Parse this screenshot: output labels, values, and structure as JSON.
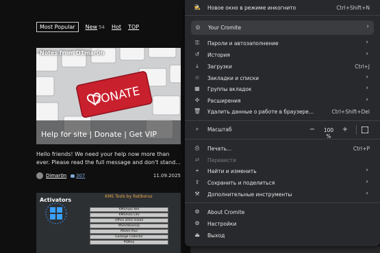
{
  "site": {
    "filters": [
      {
        "label": "Most Popular",
        "count": ""
      },
      {
        "label": "New",
        "count": "54"
      },
      {
        "label": "Hot",
        "count": ""
      },
      {
        "label": "TOP",
        "count": ""
      }
    ],
    "article": {
      "tag": "Notes from D1mar0n",
      "keyboard_key_text": "DONATE",
      "title": "Help for site | Donate | Get VIP",
      "excerpt": "Hello friends! We need your help now more than ever. Please read the full message and don't stand...",
      "author": "Dimar0n",
      "comments": "307",
      "date": "11.09.2025"
    },
    "article2": {
      "tag": "Activators",
      "title": "KMS Tools by Ratiborus",
      "items": [
        "KMSAuto Net",
        "KMSAuto Lite",
        "Office 2016 Install",
        "MSActBackUp",
        "MSAct Plus",
        "Garbage Collector",
        "PIDKey"
      ]
    }
  },
  "menu": {
    "incognito": {
      "label": "Новое окно в режиме инкогнито",
      "shortcut": "Ctrl+Shift+N"
    },
    "profile": {
      "label": "Your Cromite"
    },
    "passwords": {
      "label": "Пароли и автозаполнение"
    },
    "history": {
      "label": "История"
    },
    "downloads": {
      "label": "Загрузки",
      "shortcut": "Ctrl+J"
    },
    "bookmarks": {
      "label": "Закладки и списки"
    },
    "tab_groups": {
      "label": "Группы вкладок"
    },
    "extensions": {
      "label": "Расширения"
    },
    "clear_data": {
      "label": "Удалить данные о работе в браузере...",
      "shortcut": "Ctrl+Shift+Del"
    },
    "zoom": {
      "label": "Масштаб",
      "value": "100 %"
    },
    "print": {
      "label": "Печать...",
      "shortcut": "Ctrl+P"
    },
    "translate": {
      "label": "Перевести"
    },
    "find": {
      "label": "Найти и изменить"
    },
    "save_share": {
      "label": "Сохранить и поделиться"
    },
    "more_tools": {
      "label": "Дополнительные инструменты"
    },
    "about": {
      "label": "About Cromite"
    },
    "settings": {
      "label": "Настройки"
    },
    "exit": {
      "label": "Выход"
    }
  }
}
